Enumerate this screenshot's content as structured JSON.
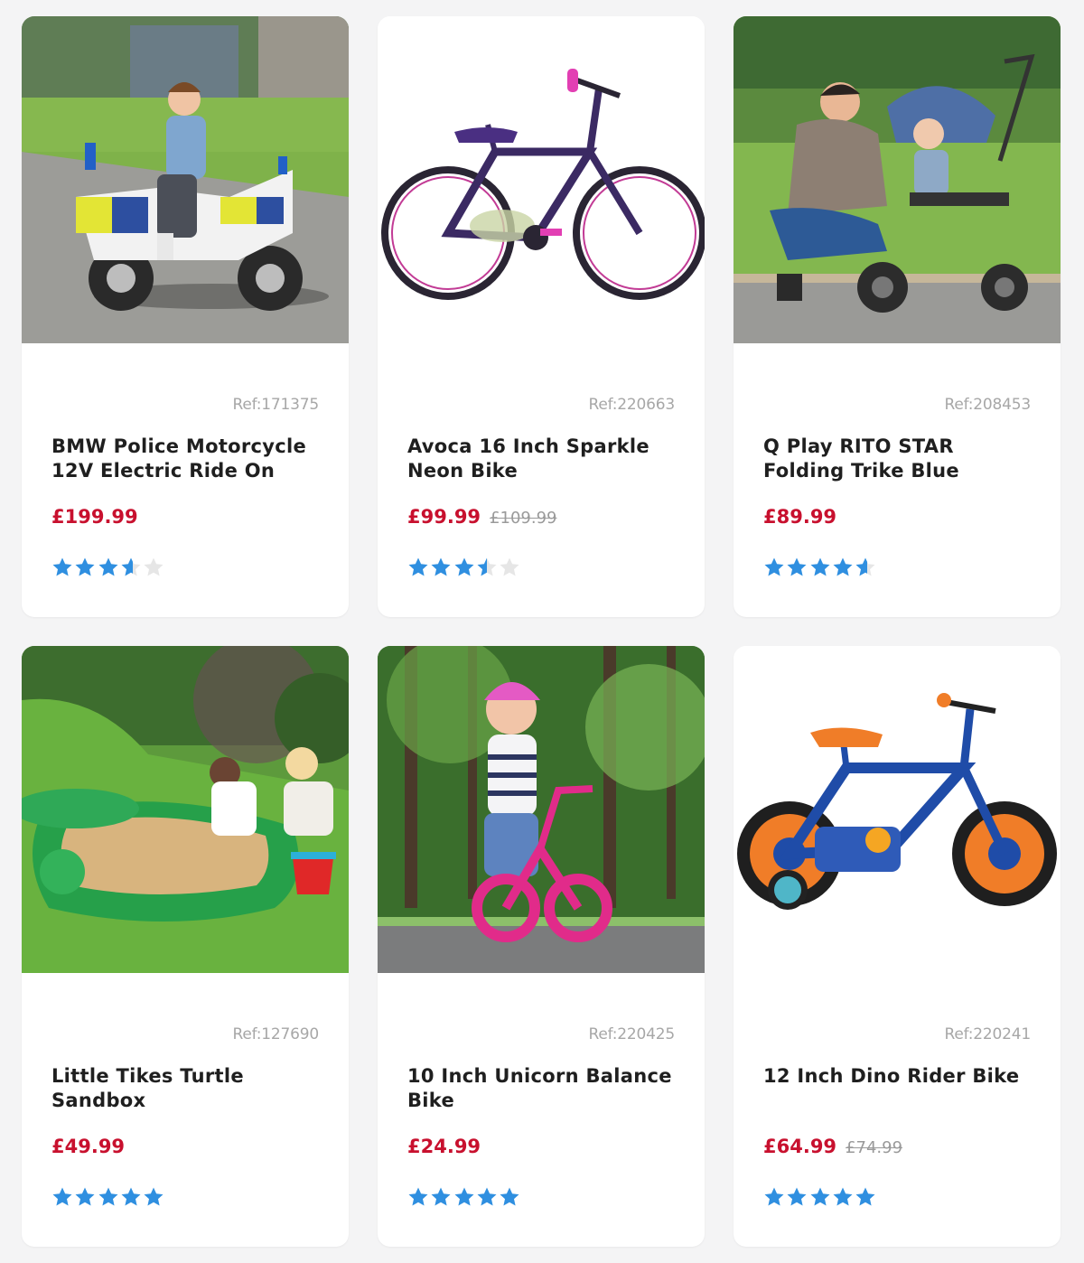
{
  "colors": {
    "price": "#c8102e",
    "star": "#2f8fe0",
    "star_empty": "#e6e6e6"
  },
  "products": [
    {
      "ref": "Ref:171375",
      "title": "BMW Police Motorcycle 12V Electric Ride On",
      "price": "£199.99",
      "was": "",
      "rating": 3.6,
      "image": "police-motorcycle-ride-on-photo"
    },
    {
      "ref": "Ref:220663",
      "title": "Avoca 16 Inch Sparkle Neon Bike",
      "price": "£99.99",
      "was": "£109.99",
      "rating": 3.5,
      "image": "purple-bike-photo"
    },
    {
      "ref": "Ref:208453",
      "title": "Q Play RITO STAR Folding Trike Blue",
      "price": "£89.99",
      "was": "",
      "rating": 4.6,
      "image": "folding-trike-photo"
    },
    {
      "ref": "Ref:127690",
      "title": "Little Tikes Turtle Sandbox",
      "price": "£49.99",
      "was": "",
      "rating": 5,
      "image": "turtle-sandbox-photo"
    },
    {
      "ref": "Ref:220425",
      "title": "10 Inch Unicorn Balance Bike",
      "price": "£24.99",
      "was": "",
      "rating": 5,
      "image": "balance-bike-photo"
    },
    {
      "ref": "Ref:220241",
      "title": "12 Inch Dino Rider Bike",
      "price": "£64.99",
      "was": "£74.99",
      "rating": 5,
      "image": "dino-bike-photo"
    }
  ]
}
